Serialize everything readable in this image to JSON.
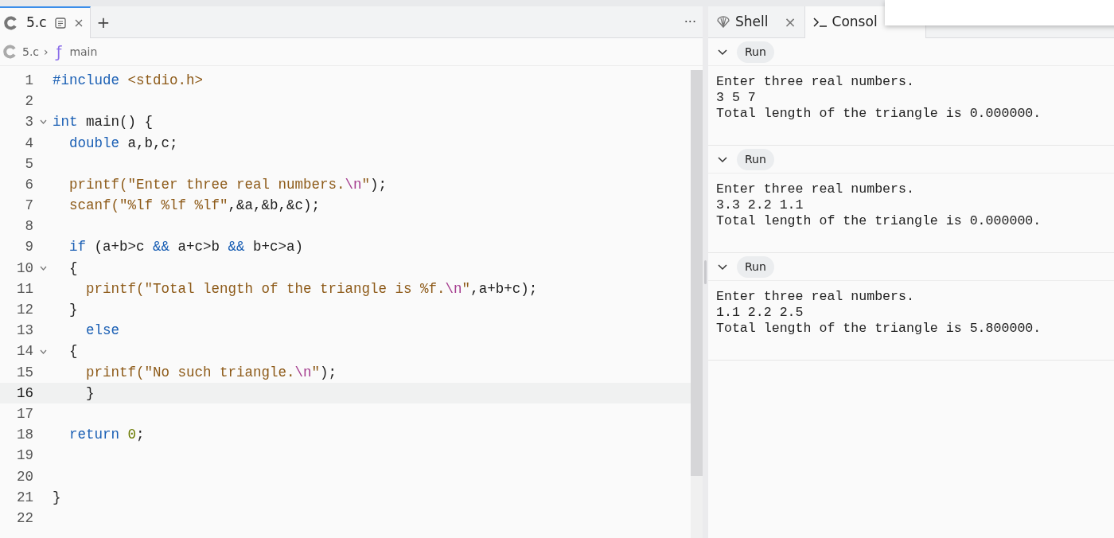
{
  "editor": {
    "tabs": [
      {
        "label": "5.c",
        "selected": true
      }
    ],
    "add_tab": "+",
    "menu": "···",
    "breadcrumb": {
      "file": "5.c",
      "separator": "›",
      "symbol_icon": "ƒ",
      "symbol": "main"
    },
    "lines": [
      {
        "number": "1",
        "fold": false,
        "active": false,
        "tokens": [
          {
            "kind": "pre",
            "text": "#include "
          },
          {
            "kind": "str",
            "text": "<stdio.h>"
          }
        ]
      },
      {
        "number": "2",
        "fold": false,
        "active": false
      },
      {
        "number": "3",
        "fold": true,
        "active": false,
        "tokens": [
          {
            "kind": "kw",
            "text": "int"
          },
          {
            "kind": "plain",
            "text": " main() {"
          }
        ]
      },
      {
        "number": "4",
        "fold": false,
        "active": false,
        "tokens": [
          {
            "kind": "kw",
            "text": "  double"
          },
          {
            "kind": "plain",
            "text": " a,b,c;"
          }
        ]
      },
      {
        "number": "5",
        "fold": false,
        "active": false
      },
      {
        "number": "6",
        "fold": false,
        "active": false,
        "tokens": [
          {
            "kind": "str",
            "text": "  printf(\"Enter three real numbers."
          },
          {
            "kind": "esc",
            "text": "\\n"
          },
          {
            "kind": "str",
            "text": "\""
          },
          {
            "kind": "plain",
            "text": ");"
          }
        ]
      },
      {
        "number": "7",
        "fold": false,
        "active": false,
        "tokens": [
          {
            "kind": "str",
            "text": "  scanf(\"%lf %lf %lf\""
          },
          {
            "kind": "plain",
            "text": ",&a,&b,&c);"
          }
        ]
      },
      {
        "number": "8",
        "fold": false,
        "active": false
      },
      {
        "number": "9",
        "fold": false,
        "active": false,
        "tokens": [
          {
            "kind": "kw",
            "text": "  if"
          },
          {
            "kind": "plain",
            "text": " (a+b>c "
          },
          {
            "kind": "kw",
            "text": "&&"
          },
          {
            "kind": "plain",
            "text": " a+c>b "
          },
          {
            "kind": "kw",
            "text": "&&"
          },
          {
            "kind": "plain",
            "text": " b+c>a)"
          }
        ]
      },
      {
        "number": "10",
        "fold": true,
        "active": false,
        "tokens": [
          {
            "kind": "plain",
            "text": "  {"
          }
        ]
      },
      {
        "number": "11",
        "fold": false,
        "active": false,
        "tokens": [
          {
            "kind": "str",
            "text": "    printf(\"Total length of the triangle is %f."
          },
          {
            "kind": "esc",
            "text": "\\n"
          },
          {
            "kind": "str",
            "text": "\""
          },
          {
            "kind": "plain",
            "text": ",a+b+c);"
          }
        ]
      },
      {
        "number": "12",
        "fold": false,
        "active": false,
        "tokens": [
          {
            "kind": "plain",
            "text": "  }"
          }
        ]
      },
      {
        "number": "13",
        "fold": false,
        "active": false,
        "tokens": [
          {
            "kind": "kw",
            "text": "    else"
          }
        ]
      },
      {
        "number": "14",
        "fold": true,
        "active": false,
        "tokens": [
          {
            "kind": "plain",
            "text": "  {"
          }
        ]
      },
      {
        "number": "15",
        "fold": false,
        "active": false,
        "tokens": [
          {
            "kind": "str",
            "text": "    printf(\"No such triangle."
          },
          {
            "kind": "esc",
            "text": "\\n"
          },
          {
            "kind": "str",
            "text": "\""
          },
          {
            "kind": "plain",
            "text": ");"
          }
        ]
      },
      {
        "number": "16",
        "fold": false,
        "active": true,
        "tokens": [
          {
            "kind": "plain",
            "text": "    }"
          }
        ]
      },
      {
        "number": "17",
        "fold": false,
        "active": false
      },
      {
        "number": "18",
        "fold": false,
        "active": false,
        "tokens": [
          {
            "kind": "kw",
            "text": "  return "
          },
          {
            "kind": "num",
            "text": "0"
          },
          {
            "kind": "plain",
            "text": ";"
          }
        ]
      },
      {
        "number": "19",
        "fold": false,
        "active": false
      },
      {
        "number": "20",
        "fold": false,
        "active": false
      },
      {
        "number": "21",
        "fold": false,
        "active": false,
        "tokens": [
          {
            "kind": "plain",
            "text": "}"
          }
        ]
      },
      {
        "number": "22",
        "fold": false,
        "active": false
      }
    ]
  },
  "console": {
    "tabs": [
      {
        "label": "Shell",
        "kind": "shell",
        "selected": false,
        "close": "×"
      },
      {
        "label": "Consol",
        "kind": "console",
        "selected": true
      }
    ],
    "runs": [
      {
        "button": "Run",
        "expanded": true,
        "lines": [
          "Enter three real numbers.",
          "3 5 7",
          "Total length of the triangle is 0.000000."
        ]
      },
      {
        "button": "Run",
        "expanded": true,
        "lines": [
          "Enter three real numbers.",
          "3.3 2.2 1.1",
          "Total length of the triangle is 0.000000."
        ]
      },
      {
        "button": "Run",
        "expanded": true,
        "lines": [
          "Enter three real numbers.",
          "1.1 2.2 2.5",
          "Total length of the triangle is 5.800000."
        ]
      }
    ]
  }
}
